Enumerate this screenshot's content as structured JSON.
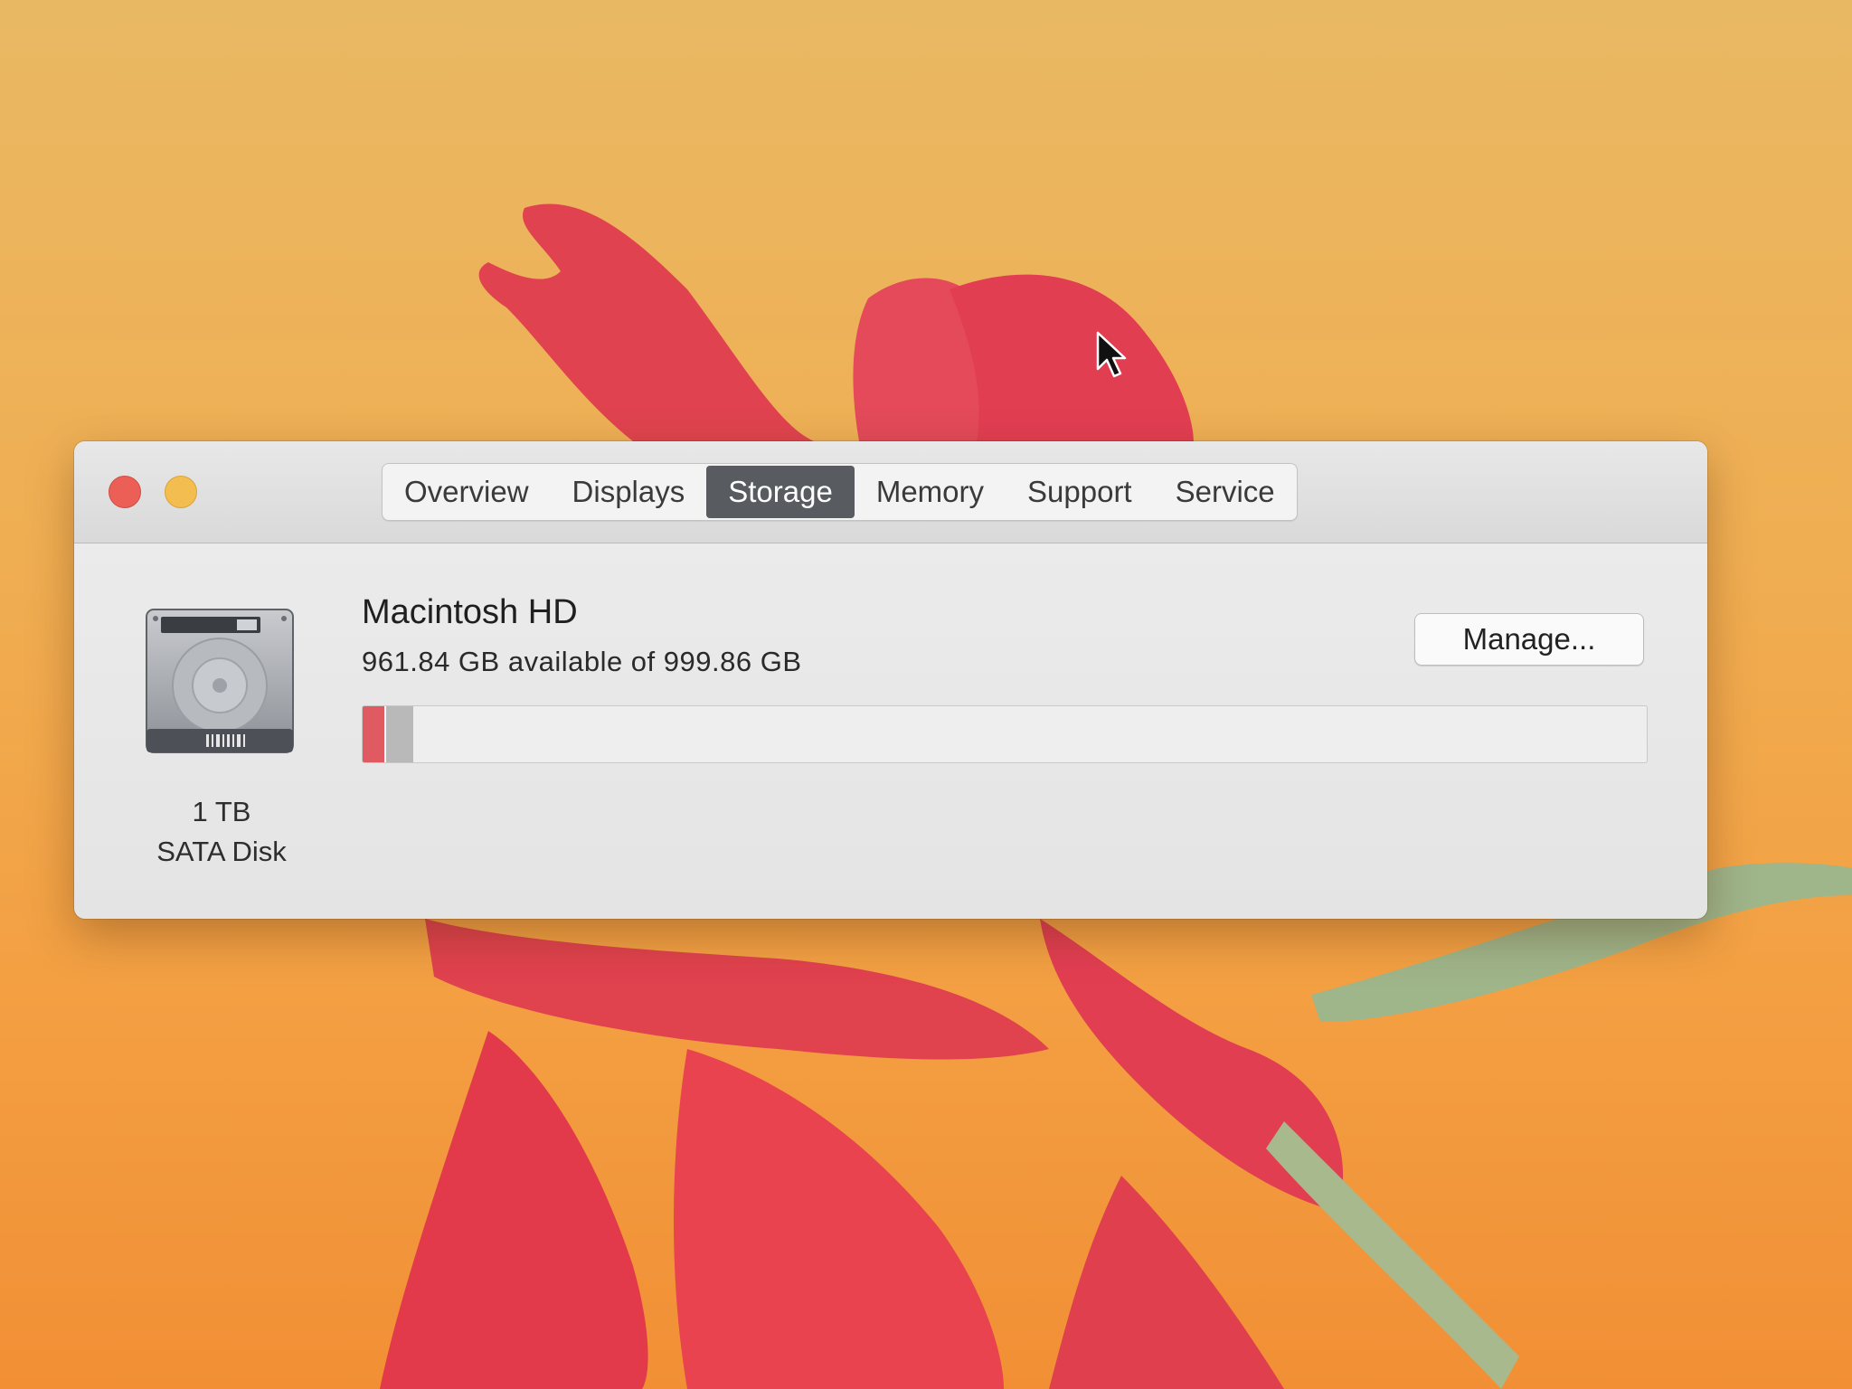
{
  "window": {
    "tabs": [
      {
        "label": "Overview"
      },
      {
        "label": "Displays"
      },
      {
        "label": "Storage"
      },
      {
        "label": "Memory"
      },
      {
        "label": "Support"
      },
      {
        "label": "Service"
      }
    ],
    "selected_tab": "Storage"
  },
  "disk": {
    "capacity": "1 TB",
    "type": "SATA Disk",
    "icon": "hard-drive-icon"
  },
  "volume": {
    "name": "Macintosh HD",
    "availability": "961.84 GB available of 999.86 GB",
    "used_fraction": 0.038,
    "manage_label": "Manage..."
  },
  "colors": {
    "close": "#ec5f57",
    "minimize": "#f3be4f",
    "selected_tab": "#585c61",
    "used_segment_a": "#e05a62",
    "used_segment_b": "#b9b9b9"
  }
}
